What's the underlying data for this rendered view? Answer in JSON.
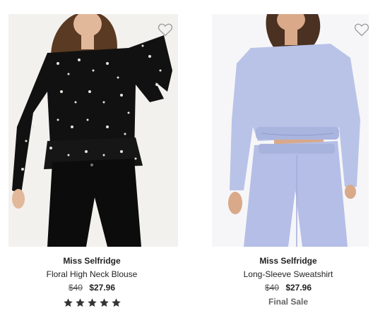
{
  "products": [
    {
      "brand": "Miss Selfridge",
      "title": "Floral High Neck Blouse",
      "original_price": "$40",
      "sale_price": "$27.96",
      "rating": 5,
      "rating_max": 5,
      "favorite_icon": "heart-outline-icon",
      "image_subject": "model in black floral long-sleeve blouse and black jeans"
    },
    {
      "brand": "Miss Selfridge",
      "title": "Long-Sleeve Sweatshirt",
      "original_price": "$40",
      "sale_price": "$27.96",
      "tag": "Final Sale",
      "favorite_icon": "heart-outline-icon",
      "image_subject": "model in lavender cropped sweatshirt and joggers"
    }
  ],
  "colors": {
    "text": "#222222",
    "muted": "#666666",
    "heart_stroke": "#9a9a9a",
    "star": "#333333",
    "sweatshirt": "#b9c3e8",
    "blouse": "#111111"
  }
}
